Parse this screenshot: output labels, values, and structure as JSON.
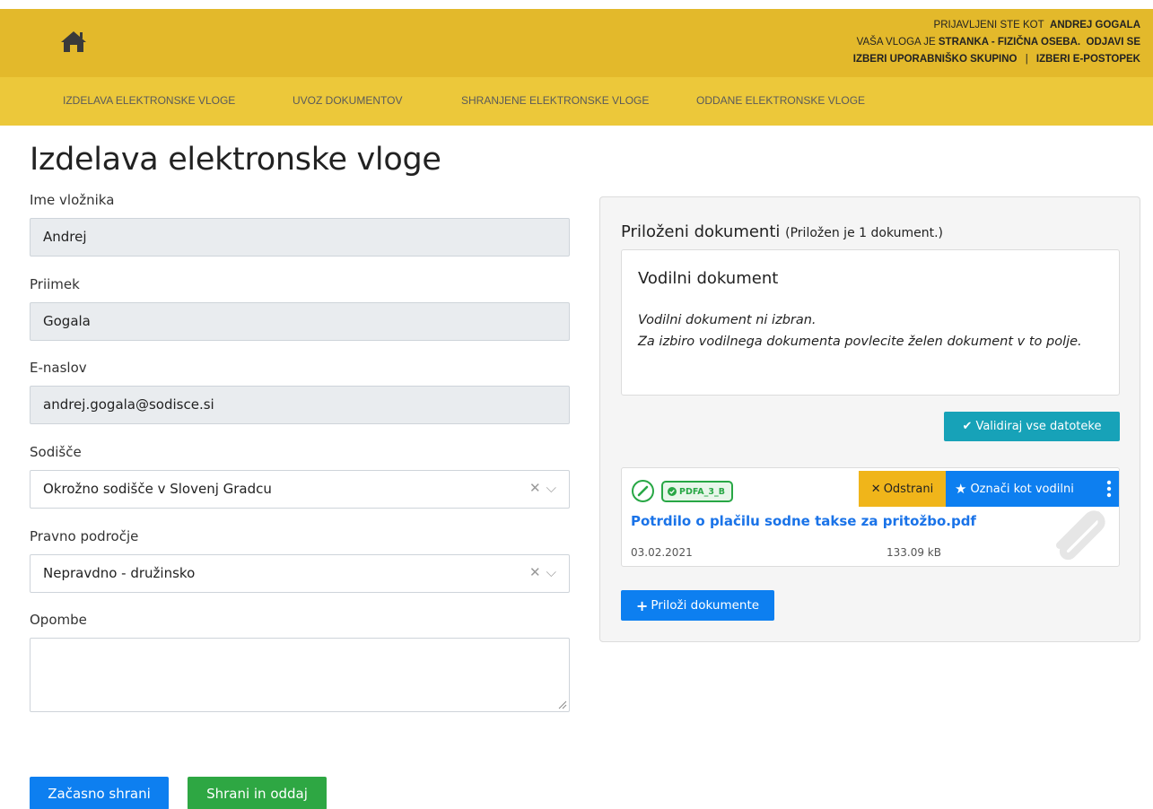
{
  "header": {
    "user_line_prefix": "PRIJAVLJENI STE KOT",
    "user_name": "ANDREJ GOGALA",
    "role_prefix": "VAŠA VLOGA JE",
    "role": "STRANKA - FIZIČNA OSEBA.",
    "logout": "ODJAVI SE",
    "choose_group": "IZBERI UPORABNIŠKO SKUPINO",
    "separator": "|",
    "choose_procedure": "IZBERI E-POSTOPEK"
  },
  "nav": {
    "items": [
      {
        "label": "IZDELAVA ELEKTRONSKE VLOGE"
      },
      {
        "label": "UVOZ DOKUMENTOV"
      },
      {
        "label": "SHRANJENE ELEKTRONSKE VLOGE"
      },
      {
        "label": "ODDANE ELEKTRONSKE VLOGE"
      }
    ]
  },
  "page": {
    "title": "Izdelava elektronske vloge"
  },
  "form": {
    "first_name": {
      "label": "Ime vložnika",
      "value": "Andrej"
    },
    "last_name": {
      "label": "Priimek",
      "value": "Gogala"
    },
    "email": {
      "label": "E-naslov",
      "value": "andrej.gogala@sodisce.si"
    },
    "court": {
      "label": "Sodišče",
      "value": "Okrožno sodišče v Slovenj Gradcu"
    },
    "legal_area": {
      "label": "Pravno področje",
      "value": "Nepravdno - družinsko"
    },
    "notes": {
      "label": "Opombe",
      "value": ""
    }
  },
  "actions": {
    "save_draft": "Začasno shrani",
    "save_submit": "Shrani in oddaj"
  },
  "attachments": {
    "title": "Priloženi dokumenti",
    "count_note": "(Priložen je 1 dokument.)",
    "guide": {
      "title": "Vodilni dokument",
      "line1": "Vodilni dokument ni izbran.",
      "line2": "Za izbiro vodilnega dokumenta povlecite želen dokument v to polje."
    },
    "validate_label": "Validiraj vse datoteke",
    "documents": [
      {
        "badge": "PDFA_3_B",
        "remove_label": "Odstrani",
        "mark_label": "Označi kot vodilni",
        "name": "Potrdilo o plačilu sodne takse za pritožbo.pdf",
        "date": "03.02.2021",
        "size": "133.09 kB"
      }
    ],
    "attach_label": "Priloži dokumente"
  },
  "colors": {
    "header_bg": "#e3b92b",
    "nav_bg": "#ecc83a",
    "primary": "#0d7ff0",
    "success": "#2ea743",
    "info": "#17a2b8",
    "warning": "#f0b51a"
  }
}
